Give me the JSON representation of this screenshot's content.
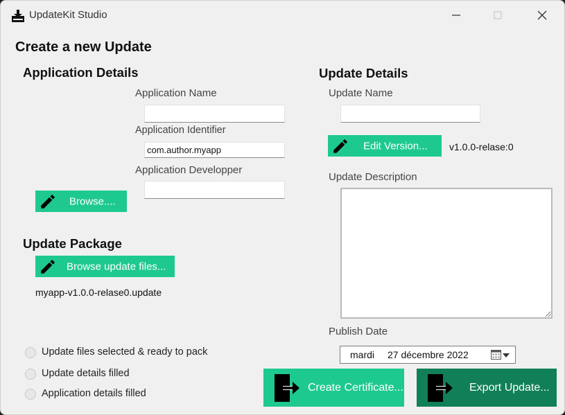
{
  "window": {
    "title": "UpdateKit Studio"
  },
  "page_title": "Create a new Update",
  "app_details": {
    "heading": "Application Details",
    "name_label": "Application Name",
    "name_value": "",
    "identifier_label": "Application Identifier",
    "identifier_value": "com.author.myapp",
    "developer_label": "Application Developper",
    "developer_value": "",
    "browse_label": "Browse...."
  },
  "update_package": {
    "heading": "Update Package",
    "browse_label": "Browse update files...",
    "file_name": "myapp-v1.0.0-relase0.update"
  },
  "status": [
    {
      "label": "Update files selected & ready to pack",
      "checked": false
    },
    {
      "label": "Update details filled",
      "checked": false
    },
    {
      "label": "Application details filled",
      "checked": false
    }
  ],
  "update_details": {
    "heading": "Update Details",
    "name_label": "Update Name",
    "name_value": "",
    "edit_version_label": "Edit Version...",
    "version_text": "v1.0.0-relase:0",
    "description_label": "Update Description",
    "publish_label": "Publish Date",
    "publish_day": "mardi",
    "publish_date": "27  décembre  2022"
  },
  "actions": {
    "create_certificate": "Create Certificate...",
    "export_update": "Export Update..."
  },
  "colors": {
    "accent": "#1ec98f",
    "accent_dark": "#118059",
    "window_bg": "#f0f0f0"
  },
  "icons": [
    "app-icon",
    "pencil-icon",
    "export-icon",
    "calendar-icon",
    "minimize-icon",
    "maximize-icon",
    "close-icon"
  ]
}
